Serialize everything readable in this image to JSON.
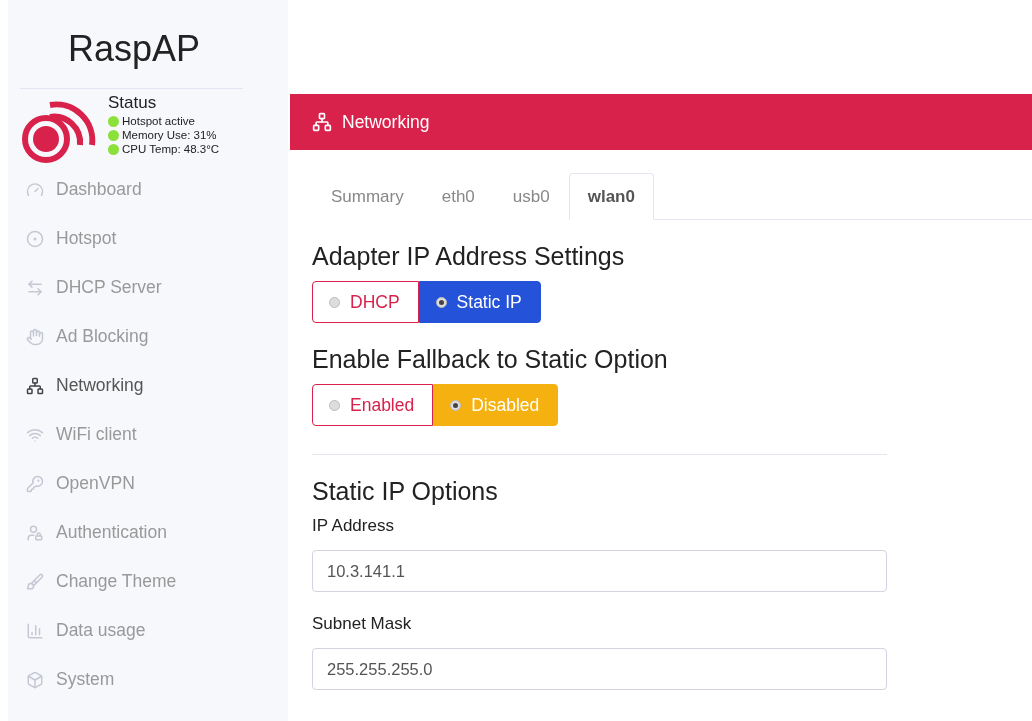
{
  "brand": "RaspAP",
  "status": {
    "title": "Status",
    "items": [
      {
        "text": "Hotspot active",
        "color": "#8ce03a"
      },
      {
        "text": "Memory Use: 31%",
        "color": "#8ce03a"
      },
      {
        "text": "CPU Temp: 48.3°C",
        "color": "#8ce03a"
      }
    ]
  },
  "sidebar": {
    "items": [
      {
        "label": "Dashboard",
        "selected": false
      },
      {
        "label": "Hotspot",
        "selected": false
      },
      {
        "label": "DHCP Server",
        "selected": false
      },
      {
        "label": "Ad Blocking",
        "selected": false
      },
      {
        "label": "Networking",
        "selected": true
      },
      {
        "label": "WiFi client",
        "selected": false
      },
      {
        "label": "OpenVPN",
        "selected": false
      },
      {
        "label": "Authentication",
        "selected": false
      },
      {
        "label": "Change Theme",
        "selected": false
      },
      {
        "label": "Data usage",
        "selected": false
      },
      {
        "label": "System",
        "selected": false
      }
    ]
  },
  "card": {
    "title": "Networking",
    "tabs": [
      {
        "label": "Summary",
        "selected": false
      },
      {
        "label": "eth0",
        "selected": false
      },
      {
        "label": "usb0",
        "selected": false
      },
      {
        "label": "wlan0",
        "selected": true
      }
    ],
    "sections": [
      {
        "kind": "toggle",
        "heading": "Adapter IP Address Settings",
        "color": "#2452d8",
        "options": [
          {
            "label": "DHCP",
            "selected": false
          },
          {
            "label": "Static IP",
            "selected": true
          }
        ]
      },
      {
        "kind": "toggle",
        "heading": "Enable Fallback to Static Option",
        "color": "#f4b10f",
        "options": [
          {
            "label": "Enabled",
            "selected": false
          },
          {
            "label": "Disabled",
            "selected": true
          }
        ]
      },
      {
        "kind": "fields",
        "heading": "Static IP Options",
        "fields": [
          {
            "label": "IP Address",
            "value": "10.3.141.1"
          },
          {
            "label": "Subnet Mask",
            "value": "255.255.255.0"
          }
        ]
      }
    ]
  }
}
